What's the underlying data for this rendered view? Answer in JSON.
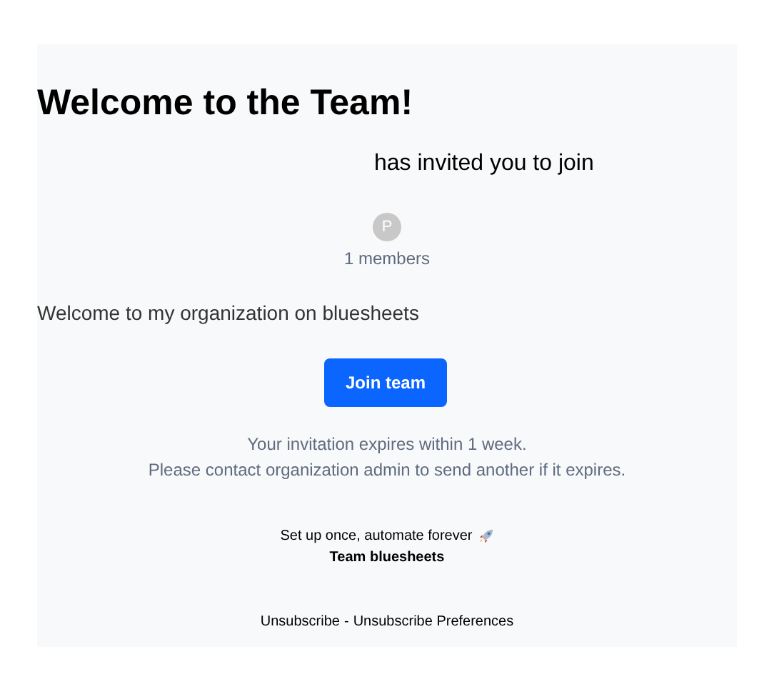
{
  "title": "Welcome to the Team!",
  "invite_text": "has invited you to join",
  "avatar": {
    "initial": "P"
  },
  "members": "1 members",
  "message": "Welcome to my organization on bluesheets",
  "join_button": "Join team",
  "expiry_lines": [
    "Your invitation expires within 1 week.",
    "Please contact organization admin to send another if it expires."
  ],
  "tagline": "Set up once, automate forever",
  "signature": "Team bluesheets",
  "footer_links": [
    "Unsubscribe",
    "Unsubscribe Preferences"
  ],
  "footer_separator": "-"
}
